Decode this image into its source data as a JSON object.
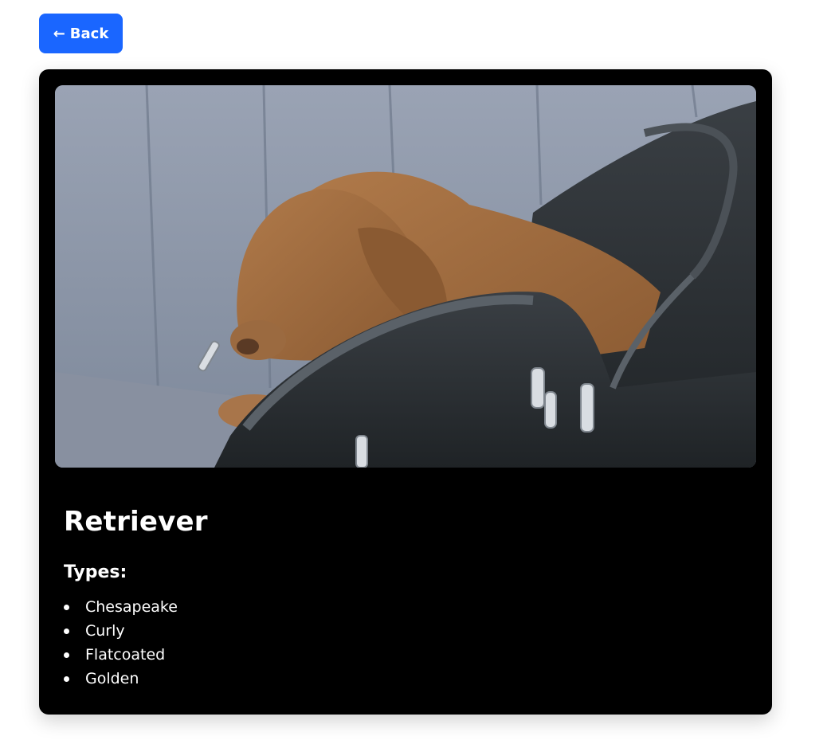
{
  "back_button": {
    "arrow": "←",
    "label": "Back",
    "color": "#1a66ff"
  },
  "card": {
    "image_icon": "dog-photo",
    "title": "Retriever",
    "types_heading": "Types:",
    "types": [
      "Chesapeake",
      "Curly",
      "Flatcoated",
      "Golden"
    ]
  }
}
